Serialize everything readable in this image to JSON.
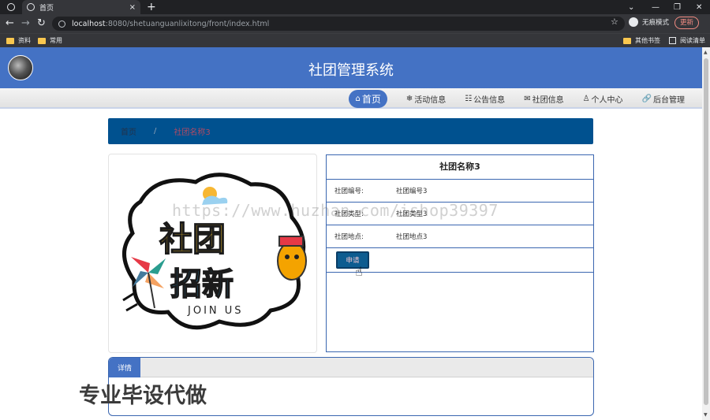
{
  "browser": {
    "tabs": [
      {
        "title": "首页",
        "close": "×"
      }
    ],
    "new_tab": "+",
    "url_host": "localhost",
    "url_path": ":8080/shetuanguanlixitong/front/index.html",
    "incognito_label": "无痕模式",
    "update_label": "更新",
    "bookmarks": [
      "资料",
      "常用",
      "其他书签",
      "阅读清单"
    ],
    "window_controls": [
      "⌄",
      "—",
      "❐",
      "✕"
    ]
  },
  "site": {
    "title": "社团管理系统",
    "menu": [
      {
        "icon": "⌂",
        "label": "首页"
      },
      {
        "icon": "❄",
        "label": "活动信息"
      },
      {
        "icon": "☷",
        "label": "公告信息"
      },
      {
        "icon": "✉",
        "label": "社团信息"
      },
      {
        "icon": "♙",
        "label": "个人中心"
      },
      {
        "icon": "🔗",
        "label": "后台管理"
      }
    ]
  },
  "breadcrumb": {
    "home": "首页",
    "separator": "/",
    "current": "社团名称3"
  },
  "poster": {
    "line1": "社团",
    "line2": "招新",
    "slogan": "JOIN US"
  },
  "club": {
    "title": "社团名称3",
    "fields": [
      {
        "label": "社团编号:",
        "value": "社团编号3"
      },
      {
        "label": "社团类型:",
        "value": "社团类型3"
      },
      {
        "label": "社团地点:",
        "value": "社团地点3"
      }
    ],
    "apply_label": "申请"
  },
  "detail": {
    "tab_label": "详情"
  },
  "overlay": {
    "watermark": "https://www.huzhan.com/ishop39397",
    "promo": "专业毕设代做"
  },
  "colors": {
    "header": "#4472c4",
    "breadcrumb": "#00518f",
    "apply_button": "#0d5c90"
  }
}
